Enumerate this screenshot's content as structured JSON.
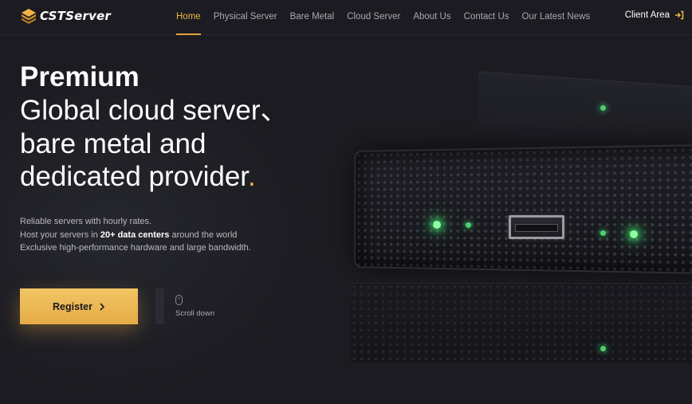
{
  "brand": {
    "name": "CSTServer",
    "accent": "#f0b544"
  },
  "nav": {
    "items": [
      {
        "label": "Home",
        "active": true
      },
      {
        "label": "Physical Server",
        "active": false
      },
      {
        "label": "Bare Metal",
        "active": false
      },
      {
        "label": "Cloud Server",
        "active": false
      },
      {
        "label": "About Us",
        "active": false
      },
      {
        "label": "Contact Us",
        "active": false
      },
      {
        "label": "Our Latest News",
        "active": false
      }
    ],
    "client_area": {
      "label": "Client Area",
      "icon": "login-arrow-icon"
    }
  },
  "hero": {
    "title_bold": "Premium",
    "title_lines": [
      "Global cloud server、",
      "bare metal and",
      "dedicated provider"
    ],
    "title_dot": ".",
    "desc_line1": "Reliable servers with hourly rates.",
    "desc_line2_pre": "Host your servers in ",
    "desc_line2_strong": "20+ data centers",
    "desc_line2_post": " around the world",
    "desc_line3": "Exclusive high-performance hardware and large bandwidth."
  },
  "cta": {
    "register_label": "Register",
    "scroll_label": "Scroll down"
  },
  "colors": {
    "background": "#1b1b21",
    "button_gradient_top": "#f2c565",
    "button_gradient_bottom": "#e5ac46",
    "led_green": "#8dff9e"
  }
}
